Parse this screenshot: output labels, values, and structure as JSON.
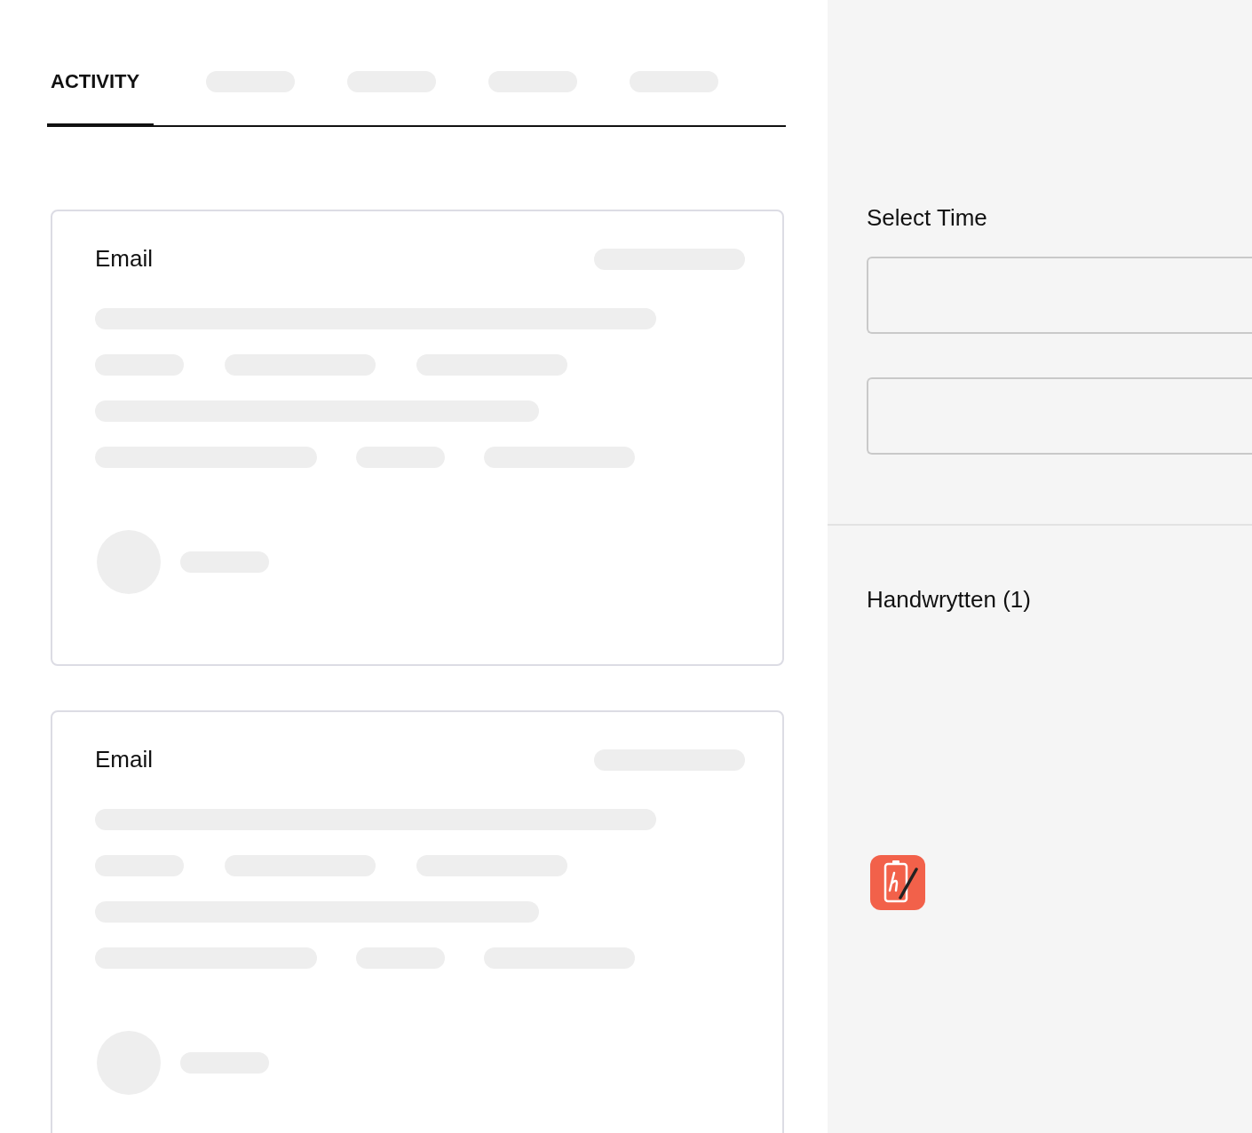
{
  "tabs": [
    {
      "label": "ACTIVITY",
      "selected": true
    },
    {
      "selected": false
    },
    {
      "selected": false
    },
    {
      "selected": false
    },
    {
      "selected": false
    }
  ],
  "activity_cards": [
    {
      "title": "Email"
    },
    {
      "title": "Email"
    }
  ],
  "side_panel": {
    "select_time": {
      "label": "Select Time"
    },
    "handwrytten": {
      "label": "Handwrytten (1)"
    }
  }
}
